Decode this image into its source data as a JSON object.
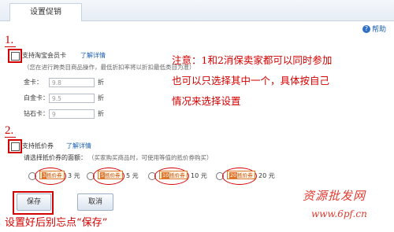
{
  "tab": {
    "title": "设置促销"
  },
  "help": {
    "label": "帮助",
    "icon": "?"
  },
  "section1": {
    "number": "1.",
    "label": "支持淘宝会员卡",
    "link": "了解详情",
    "hint": "（您在进行跨类目商品操作，最低折扣率将以折扣最低类目为准）",
    "fields": [
      {
        "label": "金卡：",
        "value": "9.8",
        "unit": "折"
      },
      {
        "label": "白金卡：",
        "value": "9.5",
        "unit": "折"
      },
      {
        "label": "钻石卡：",
        "value": "9",
        "unit": "折"
      }
    ]
  },
  "note": {
    "lines": [
      "注意：1和2消保卖家都可以同时参加",
      "也可以只选择其中一个，具体按自己",
      "情况来选择设置"
    ]
  },
  "section2": {
    "number": "2.",
    "label": "支持抵价券",
    "link": "了解详情",
    "prompt": "请选择抵价券的面额：",
    "hint": "（买家购买商品时，可使用等值的抵价券购买）",
    "coupons": [
      {
        "tag": "抵价券",
        "amount": "3",
        "unit": "元"
      },
      {
        "tag": "抵价券",
        "amount": "5",
        "unit": "元"
      },
      {
        "tag": "抵价券",
        "amount": "10",
        "unit": "元"
      },
      {
        "tag": "抵价券",
        "amount": "20",
        "unit": "元"
      }
    ]
  },
  "buttons": {
    "save": "保存",
    "cancel": "取消"
  },
  "footer_note": "设置好后别忘点“保存”",
  "watermark": {
    "brand": "资源批发网",
    "url": "www.6pf.cn"
  }
}
